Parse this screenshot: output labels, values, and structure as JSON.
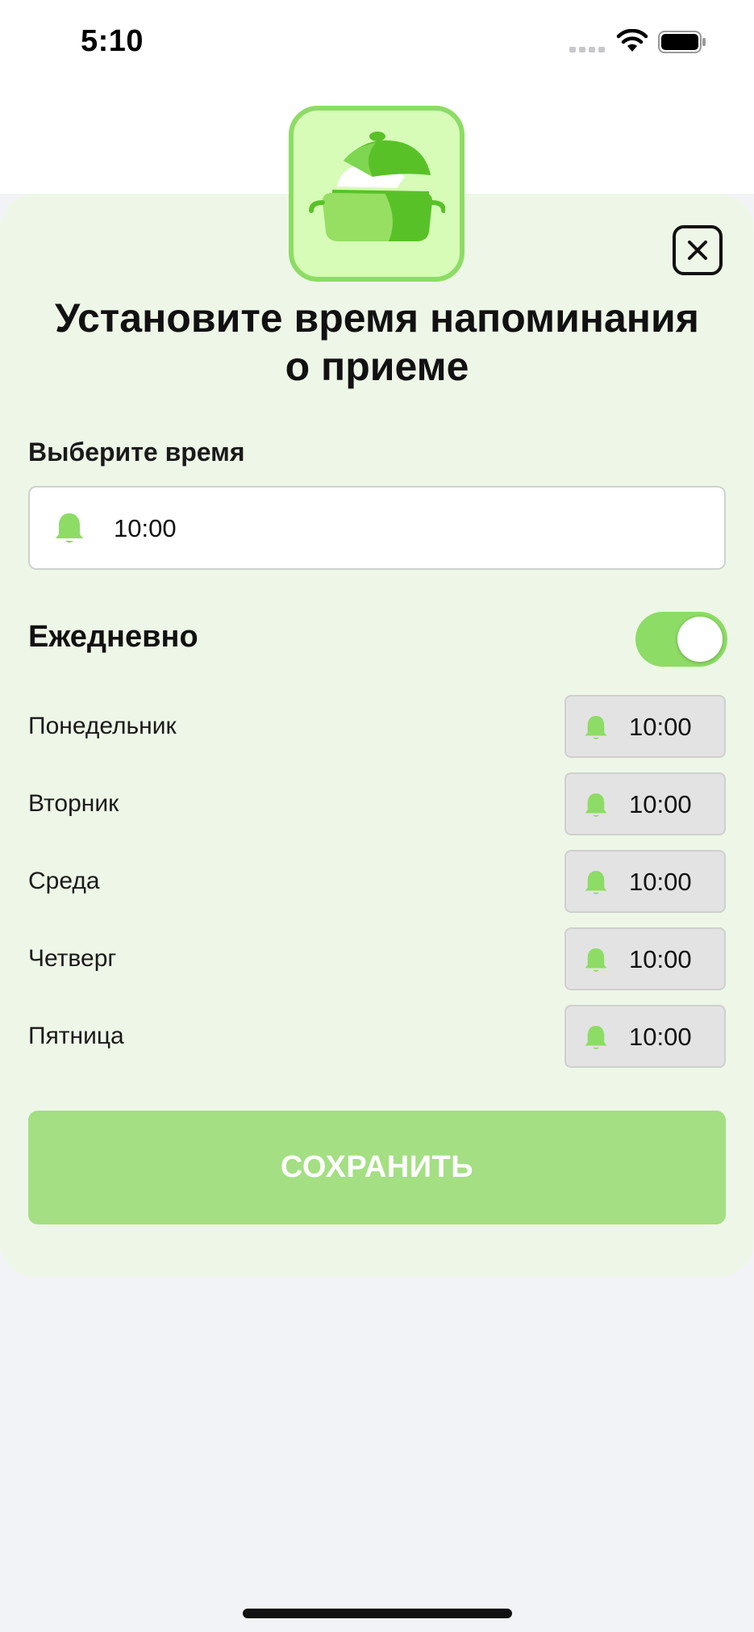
{
  "status_bar": {
    "time": "5:10",
    "icons": [
      "signal-icon",
      "wifi-icon",
      "battery-icon"
    ]
  },
  "app_icon": {
    "icon": "cooking-pot-icon"
  },
  "close": {
    "icon": "close-icon"
  },
  "title": "Установите время напоминания о приеме",
  "time_select": {
    "label": "Выберите время",
    "icon": "bell-icon",
    "value": "10:00"
  },
  "daily": {
    "label": "Ежедневно",
    "enabled": true
  },
  "days": [
    {
      "name": "Понедельник",
      "time": "10:00"
    },
    {
      "name": "Вторник",
      "time": "10:00"
    },
    {
      "name": "Среда",
      "time": "10:00"
    },
    {
      "name": "Четверг",
      "time": "10:00"
    },
    {
      "name": "Пятница",
      "time": "10:00"
    }
  ],
  "save_button": {
    "label": "СОХРАНИТЬ"
  },
  "colors": {
    "accent": "#8ddc65",
    "sheet_bg": "#eef7e7",
    "save_bg": "#a4df83",
    "icon_bg": "#d6fcb7"
  }
}
